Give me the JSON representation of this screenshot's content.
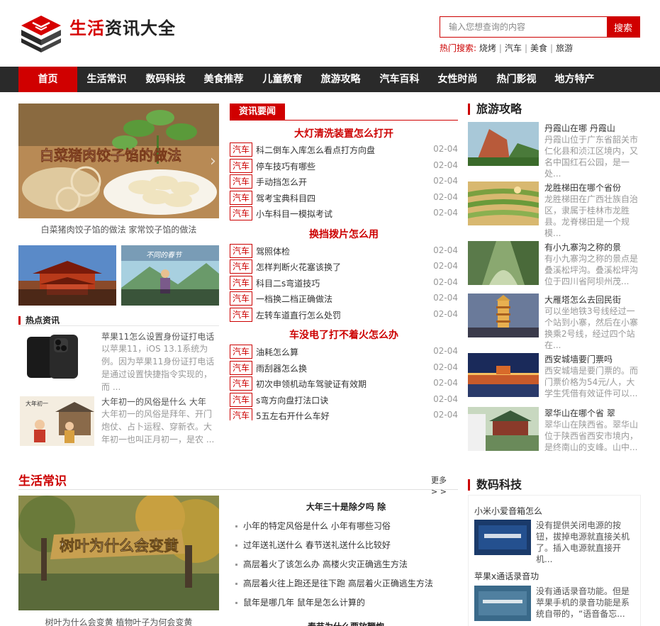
{
  "header": {
    "logo_text_red": "生活",
    "logo_text_black": "资讯大全",
    "search_placeholder": "输入您想查询的内容",
    "search_button": "搜索",
    "hot_label": "热门搜索:",
    "hot_keywords": [
      "烧烤",
      "汽车",
      "美食",
      "旅游"
    ]
  },
  "nav": {
    "items": [
      "首页",
      "生活常识",
      "数码科技",
      "美食推荐",
      "儿童教育",
      "旅游攻略",
      "汽车百科",
      "女性时尚",
      "热门影视",
      "地方特产"
    ]
  },
  "featured": {
    "overlay_text": "白菜猪肉饺子馅的做法",
    "caption": "白菜猪肉饺子馅的做法 家常饺子馅的做法",
    "thumb2_text": "不同的春节"
  },
  "hot_news": {
    "title": "热点资讯",
    "items": [
      {
        "title": "苹果11怎么设置身份证打电话",
        "desc": "以苹果11，iOS 13.1系统为例。因为苹果11身份证打电话是通过设置快捷指令实现的，而 ..."
      },
      {
        "title": "大年初一的风俗是什么 大年",
        "desc": "大年初一的风俗是拜年、开门炮仗、占卜运程、穿新衣。大年初一也叫正月初一，是农 ..."
      }
    ],
    "thumb2_text": "大年初一"
  },
  "news": {
    "tab": "资讯要闻",
    "groups": [
      {
        "headline": "大灯清洗装置怎么打开",
        "rows": [
          {
            "tag": "汽车",
            "title": "科二倒车入库怎么看点打方向盘",
            "date": "02-04"
          },
          {
            "tag": "汽车",
            "title": "停车技巧有哪些",
            "date": "02-04"
          },
          {
            "tag": "汽车",
            "title": "手动挡怎么开",
            "date": "02-04"
          },
          {
            "tag": "汽车",
            "title": "驾考宝典科目四",
            "date": "02-04"
          },
          {
            "tag": "汽车",
            "title": "小车科目一模拟考试",
            "date": "02-04"
          }
        ]
      },
      {
        "headline": "换挡拨片怎么用",
        "rows": [
          {
            "tag": "汽车",
            "title": "驾照体检",
            "date": "02-04"
          },
          {
            "tag": "汽车",
            "title": "怎样判断火花塞该换了",
            "date": "02-04"
          },
          {
            "tag": "汽车",
            "title": "科目二s弯道技巧",
            "date": "02-04"
          },
          {
            "tag": "汽车",
            "title": "一档换二档正确做法",
            "date": "02-04"
          },
          {
            "tag": "汽车",
            "title": "左转车道直行怎么处罚",
            "date": "02-04"
          }
        ]
      },
      {
        "headline": "车没电了打不着火怎么办",
        "rows": [
          {
            "tag": "汽车",
            "title": "油耗怎么算",
            "date": "02-04"
          },
          {
            "tag": "汽车",
            "title": "雨刮器怎么换",
            "date": "02-04"
          },
          {
            "tag": "汽车",
            "title": "初次申领机动车驾驶证有效期",
            "date": "02-04"
          },
          {
            "tag": "汽车",
            "title": "s弯方向盘打法口诀",
            "date": "02-04"
          },
          {
            "tag": "汽车",
            "title": "5五左右开什么车好",
            "date": "02-04"
          }
        ]
      }
    ]
  },
  "travel": {
    "title": "旅游攻略",
    "items": [
      {
        "title": "丹霞山在哪 丹霞山",
        "desc": "丹霞山位于广东省韶关市仁化县和浈江区境内，又名中国红石公园，是一处..."
      },
      {
        "title": "龙胜梯田在哪个省份",
        "desc": "龙胜梯田在广西壮族自治区，隶属于桂林市龙胜县。龙脊梯田是一个规模..."
      },
      {
        "title": "有小九寨沟之称的景",
        "desc": "有小九寨沟之称的景点是叠溪松坪沟。叠溪松坪沟位于四川省阿坝州茂..."
      },
      {
        "title": "大雁塔怎么去回民街",
        "desc": "可以坐地铁3号线经过一个站到小寨，然后在小寨换乘2号线，经过四个站在..."
      },
      {
        "title": "西安城墙要门票吗",
        "desc": "西安城墙是要门票的。而门票价格为54元/人，大学生凭借有效证件可以..."
      },
      {
        "title": "翠华山在哪个省 翠",
        "desc": "翠华山在陕西省。翠华山位于陕西省西安市境内，是终南山的支峰。山中..."
      }
    ]
  },
  "life": {
    "title": "生活常识",
    "more": "更多> >",
    "image_text": "树叶为什么会变黄",
    "caption": "树叶为什么会变黄 植物叶子为何会变黄",
    "headline": "大年三十是除夕吗 除",
    "items": [
      "小年的特定风俗是什么 小年有哪些习俗",
      "过年送礼送什么 春节送礼送什么比较好",
      "高层着火了该怎么办 高楼火灾正确逃生方法",
      "高层着火往上跑还是往下跑 高层着火正确逃生方法",
      "鼠年是哪几年 鼠年是怎么计算的"
    ],
    "bottom_headline": "春节为什么要放鞭炮"
  },
  "digital": {
    "title": "数码科技",
    "items": [
      {
        "title": "小米小爱音箱怎么",
        "desc": "没有提供关闭电源的按钮，拔掉电源就直接关机了。插入电源就直接开机..."
      },
      {
        "title": "苹果x通话录音功",
        "desc": "没有通话录音功能。但是苹果手机的录音功能是系统自带的，“语音备忘..."
      }
    ]
  }
}
